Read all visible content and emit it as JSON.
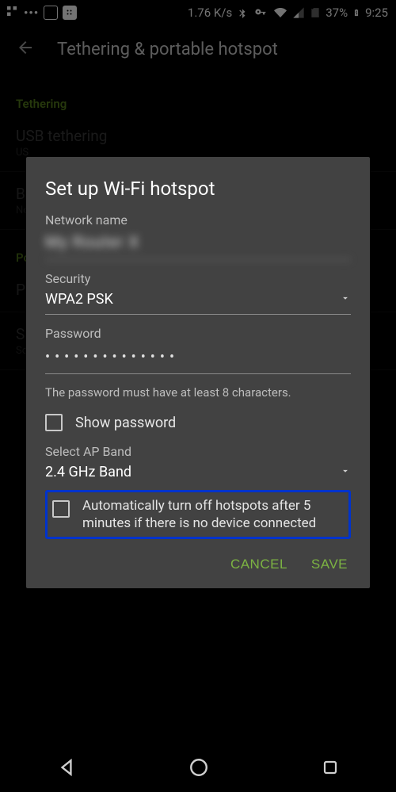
{
  "statusbar": {
    "data_rate": "1.76 K/s",
    "battery_pct": "37%",
    "time": "9:25"
  },
  "toolbar": {
    "title": "Tethering & portable hotspot"
  },
  "background": {
    "section1": "Tethering",
    "usb_title": "USB tethering",
    "usb_sub": "US",
    "bt_title": "B",
    "bt_sub": "No",
    "section2": "Po",
    "p_title": "P",
    "s_title": "S",
    "s_sub": "So"
  },
  "dialog": {
    "title": "Set up Wi-Fi hotspot",
    "network_label": "Network name",
    "network_value": "My Router X",
    "security_label": "Security",
    "security_value": "WPA2 PSK",
    "password_label": "Password",
    "password_value": "••••••••••••••",
    "password_hint": "The password must have at least 8 characters.",
    "show_password": "Show password",
    "ap_band_label": "Select AP Band",
    "ap_band_value": "2.4 GHz Band",
    "auto_off": "Automatically turn off hotspots after 5 minutes if there is no device connected",
    "cancel": "CANCEL",
    "save": "SAVE"
  }
}
